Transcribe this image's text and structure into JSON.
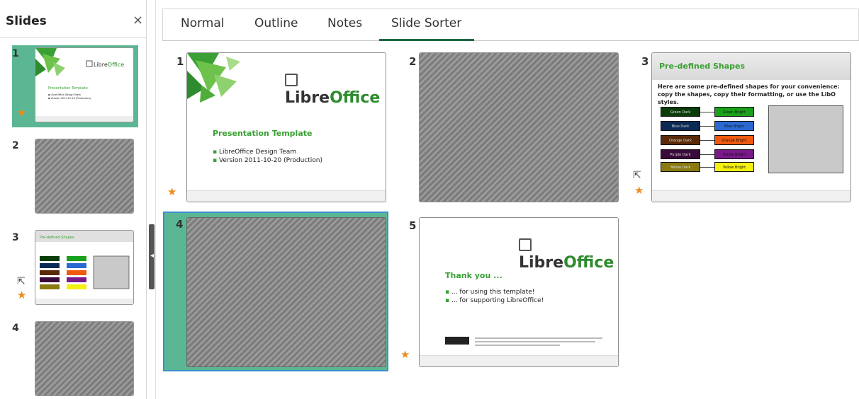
{
  "sidebar": {
    "title": "Slides",
    "close": "×",
    "items": [
      {
        "num": "1"
      },
      {
        "num": "2"
      },
      {
        "num": "3"
      },
      {
        "num": "4"
      }
    ]
  },
  "tabs": [
    {
      "label": "Normal"
    },
    {
      "label": "Outline"
    },
    {
      "label": "Notes"
    },
    {
      "label": "Slide Sorter"
    }
  ],
  "slides": [
    {
      "num": "1",
      "logo_libre": "Libre",
      "logo_office": "Office",
      "title": "Presentation Template",
      "bullets": [
        "LibreOffice Design Team",
        "Version 2011-10-20 (Production)"
      ]
    },
    {
      "num": "2"
    },
    {
      "num": "3",
      "title": "Pre-defined Shapes",
      "text": "Here are some pre-defined shapes for your convenience: copy the shapes, copy their formatting, or use the LibO styles.",
      "shapes": [
        {
          "left": "Green Dark",
          "right": "Green Bright",
          "lcolor": "#0b3d0b",
          "rcolor": "#1aa01a"
        },
        {
          "left": "Blue Dark",
          "right": "Blue Bright",
          "lcolor": "#0b2a55",
          "rcolor": "#2a6ad0"
        },
        {
          "left": "Orange Dark",
          "right": "Orange Bright",
          "lcolor": "#5a2a08",
          "rcolor": "#f05a10"
        },
        {
          "left": "Purple Dark",
          "right": "Purple Bright",
          "lcolor": "#3a0a3a",
          "rcolor": "#7a1a8a"
        },
        {
          "left": "Yellow Dark",
          "right": "Yellow Bright",
          "lcolor": "#8a7a10",
          "rcolor": "#f4f010"
        }
      ]
    },
    {
      "num": "4"
    },
    {
      "num": "5",
      "logo_libre": "Libre",
      "logo_office": "Office",
      "title": "Thank you ...",
      "bullets": [
        "... for using this template!",
        "... for supporting LibreOffice!"
      ]
    }
  ],
  "icons": {
    "custom_animation": "★",
    "cursor": "⇱"
  },
  "colors": {
    "selection": "#5bb793",
    "accent": "#3aa034",
    "tab_underline": "#1f6a43",
    "focus_border": "#3a8fd0"
  }
}
